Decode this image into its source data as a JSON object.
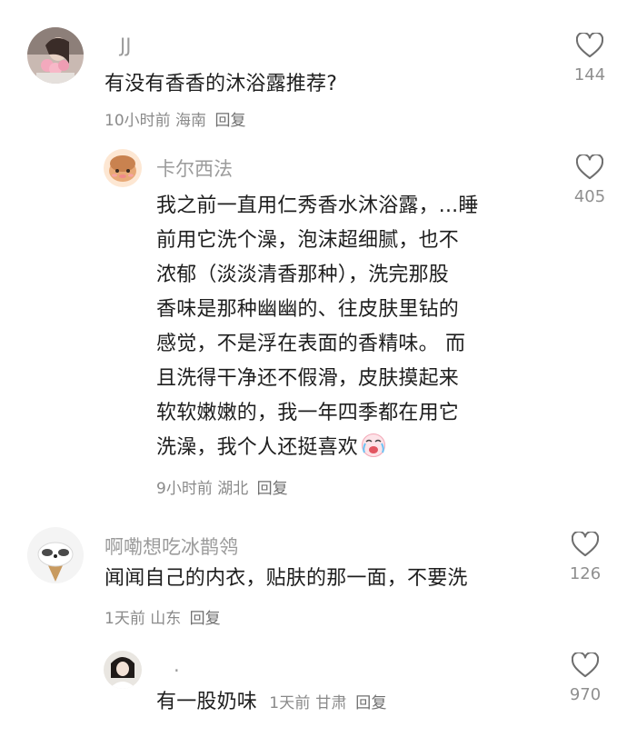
{
  "comments": [
    {
      "user": "JJ",
      "text": "有没有香香的沐浴露推荐?",
      "time": "10小时前",
      "location": "海南",
      "reply": "回复",
      "likes": "144",
      "replies": [
        {
          "user": "卡尔西法",
          "lines": [
            "我之前一直用仁秀香水沐浴露，...睡",
            "前用它洗个澡，泡沫超细腻，也不",
            "浓郁（淡淡清香那种），洗完那股",
            "香味是那种幽幽的、往皮肤里钻的",
            "感觉，不是浮在表面的香精味。 而",
            "且洗得干净还不假滑，皮肤摸起来",
            "软软嫩嫩的，我一年四季都在用它",
            "洗澡，我个人还挺喜欢"
          ],
          "emoji": "crying-laughing-emoji",
          "time": "9小时前",
          "location": "湖北",
          "reply": "回复",
          "likes": "405"
        }
      ]
    },
    {
      "user": "啊嘞想吃冰鹊鸰",
      "text": "闻闻自己的内衣，贴肤的那一面，不要洗",
      "time": "1天前",
      "location": "山东",
      "reply": "回复",
      "likes": "126",
      "replies": [
        {
          "user": ".",
          "text": "有一股奶味",
          "time": "1天前",
          "location": "甘肃",
          "reply": "回复",
          "likes": "970"
        }
      ]
    }
  ],
  "icons": {
    "like": "heart-outline-icon"
  },
  "colors": {
    "name": "#9b9b9b",
    "text": "#1e1e1e",
    "meta": "#8a8a8a",
    "heart": "#6e6e6e"
  }
}
